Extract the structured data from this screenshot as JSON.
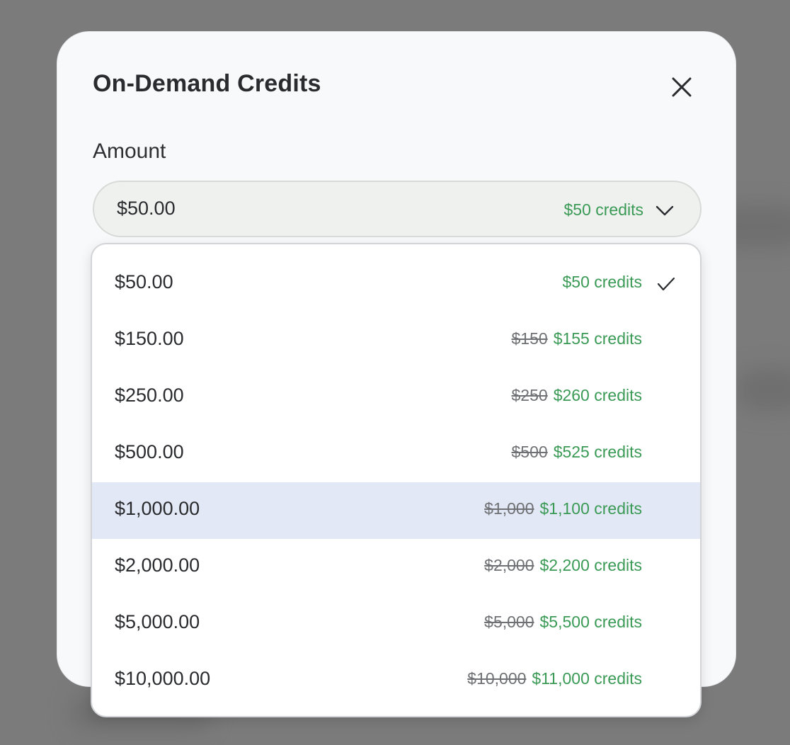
{
  "modal": {
    "title": "On-Demand Credits",
    "close_icon": "close-icon"
  },
  "amount_field": {
    "label": "Amount",
    "selected_value": "$50.00",
    "selected_credits": "$50 credits",
    "chevron_icon": "chevron-down-icon"
  },
  "dropdown": {
    "options": [
      {
        "amount": "$50.00",
        "original": "",
        "credits": "$50 credits",
        "selected": true
      },
      {
        "amount": "$150.00",
        "original": "$150",
        "credits": "$155 credits"
      },
      {
        "amount": "$250.00",
        "original": "$250",
        "credits": "$260 credits"
      },
      {
        "amount": "$500.00",
        "original": "$500",
        "credits": "$525 credits"
      },
      {
        "amount": "$1,000.00",
        "original": "$1,000",
        "credits": "$1,100 credits",
        "highlighted": true
      },
      {
        "amount": "$2,000.00",
        "original": "$2,000",
        "credits": "$2,200 credits"
      },
      {
        "amount": "$5,000.00",
        "original": "$5,000",
        "credits": "$5,500 credits"
      },
      {
        "amount": "$10,000.00",
        "original": "$10,000",
        "credits": "$11,000 credits"
      }
    ],
    "check_icon": "checkmark-icon"
  },
  "colors": {
    "credits_green": "#3a9a55",
    "highlight_row": "#e2e8f5",
    "overlay": "#7b7b7b"
  }
}
